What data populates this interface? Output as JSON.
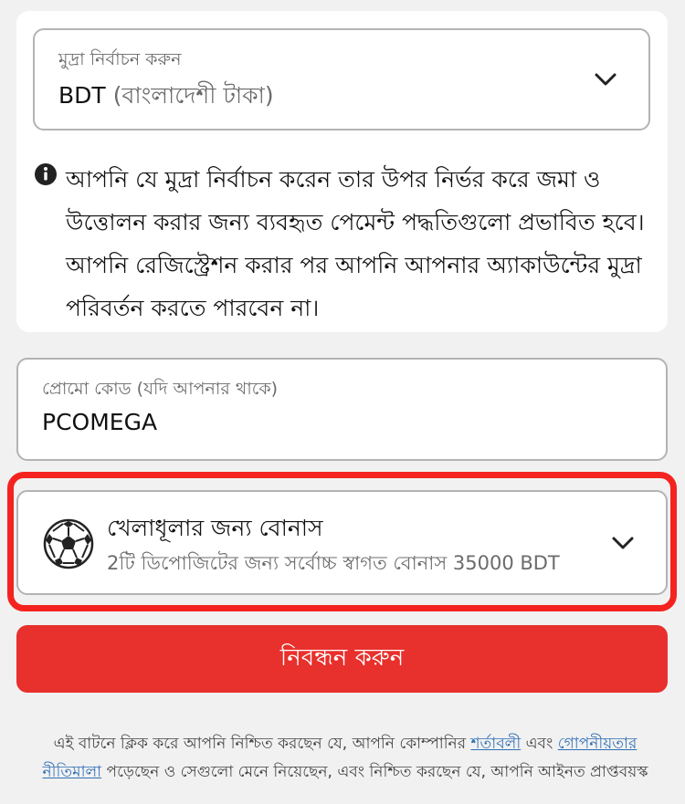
{
  "currency": {
    "label": "মুদ্রা নির্বাচন করুন",
    "code": "BDT",
    "name": "(বাংলাদেশী টাকা)",
    "info_text": "আপনি যে মুদ্রা নির্বাচন করেন তার উপর নির্ভর করে জমা ও উত্তোলন করার জন্য ব্যবহৃত পেমেন্ট পদ্ধতিগুলো প্রভাবিত হবে। আপনি রেজিস্ট্রেশন করার পর আপনি আপনার অ্যাকাউন্টের মুদ্রা পরিবর্তন করতে পারবেন না।"
  },
  "promo": {
    "label": "প্রোমো কোড (যদি আপনার থাকে)",
    "value": "PCOMEGA"
  },
  "bonus": {
    "icon": "soccer-ball-icon",
    "title": "খেলাধূলার জন্য বোনাস",
    "description": "2টি ডিপোজিটের জন্য সর্বোচ্চ স্বাগত বোনাস 35000 BDT"
  },
  "register": {
    "label": "নিবন্ধন করুন"
  },
  "terms": {
    "prefix": "এই বাটনে ক্লিক করে আপনি নিশ্চিত করছেন যে, আপনি কোম্পানির ",
    "terms_link": "শর্তাবলী",
    "middle": " এবং ",
    "privacy_link": "গোপনীয়তার নীতিমালা",
    "suffix": " পড়েছেন ও সেগুলো মেনে নিয়েছেন, এবং নিশ্চিত করছেন যে, আপনি আইনত প্রাপ্তবয়স্ক"
  },
  "colors": {
    "accent": "#e8302c",
    "highlight": "#f4231f",
    "link": "#2e6fb5"
  }
}
